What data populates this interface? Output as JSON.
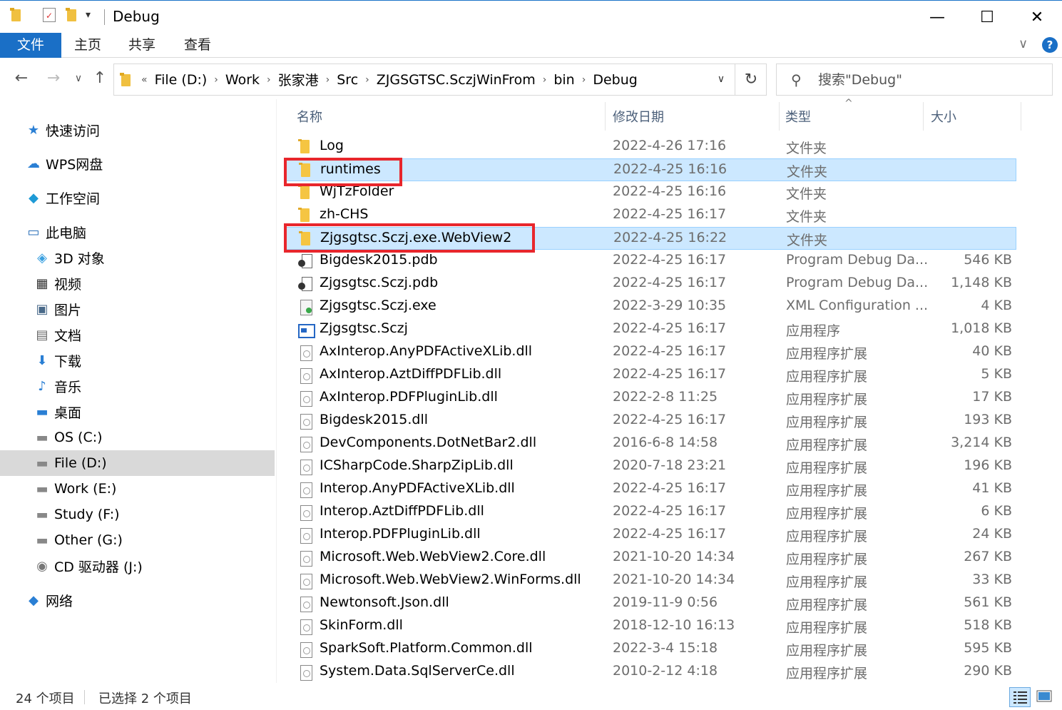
{
  "window": {
    "title": "Debug",
    "minimize_glyph": "—",
    "maximize_glyph": "☐",
    "close_glyph": "✕"
  },
  "ribbon": {
    "tabs": [
      "文件",
      "主页",
      "共享",
      "查看"
    ],
    "expand_glyph": "∨",
    "help_glyph": "?"
  },
  "nav": {
    "back_glyph": "←",
    "forward_glyph": "→",
    "recent_glyph": "∨",
    "up_glyph": "↑"
  },
  "address": {
    "overflow": "«",
    "crumbs": [
      "File (D:)",
      "Work",
      "张家港",
      "Src",
      "ZJGSGTSC.SczjWinFrom",
      "bin",
      "Debug"
    ],
    "separator": "›",
    "dropdown_glyph": "∨",
    "refresh_glyph": "↻"
  },
  "search": {
    "placeholder": "搜索\"Debug\"",
    "icon": "search-icon"
  },
  "sidebar": {
    "items": [
      {
        "label": "快速访问",
        "icon": "star-icon",
        "glyph": "★",
        "color": "#2a7fd4"
      },
      {
        "label": "WPS网盘",
        "icon": "cloud-icon",
        "glyph": "☁",
        "color": "#2a7fd4"
      },
      {
        "label": "工作空间",
        "icon": "workspace-icon",
        "glyph": "◆",
        "color": "#1e9ad6"
      },
      {
        "label": "此电脑",
        "icon": "computer-icon",
        "glyph": "▭",
        "color": "#2a6fb8"
      },
      {
        "label": "3D 对象",
        "icon": "cube-icon",
        "glyph": "◈",
        "color": "#3aa0e0"
      },
      {
        "label": "视频",
        "icon": "film-icon",
        "glyph": "▦",
        "color": "#333"
      },
      {
        "label": "图片",
        "icon": "picture-icon",
        "glyph": "▣",
        "color": "#4a6a8a"
      },
      {
        "label": "文档",
        "icon": "document-icon",
        "glyph": "▤",
        "color": "#666"
      },
      {
        "label": "下载",
        "icon": "download-icon",
        "glyph": "⬇",
        "color": "#2a7fd4"
      },
      {
        "label": "音乐",
        "icon": "music-icon",
        "glyph": "♪",
        "color": "#2a7fd4"
      },
      {
        "label": "桌面",
        "icon": "desktop-icon",
        "glyph": "▬",
        "color": "#2a7fd4"
      },
      {
        "label": "OS (C:)",
        "icon": "drive-icon",
        "glyph": "▬",
        "color": "#888"
      },
      {
        "label": "File (D:)",
        "icon": "drive-icon",
        "glyph": "▬",
        "color": "#888"
      },
      {
        "label": "Work (E:)",
        "icon": "drive-icon",
        "glyph": "▬",
        "color": "#888"
      },
      {
        "label": "Study (F:)",
        "icon": "drive-icon",
        "glyph": "▬",
        "color": "#888"
      },
      {
        "label": "Other (G:)",
        "icon": "drive-icon",
        "glyph": "▬",
        "color": "#888"
      },
      {
        "label": "CD 驱动器 (J:)",
        "icon": "cd-drive-icon",
        "glyph": "◉",
        "color": "#777"
      },
      {
        "label": "网络",
        "icon": "network-icon",
        "glyph": "◆",
        "color": "#2a7fd4"
      }
    ],
    "selected_index": 12
  },
  "columns": {
    "name": "名称",
    "date": "修改日期",
    "type": "类型",
    "size": "大小",
    "sort_glyph": "^"
  },
  "files": [
    {
      "name": "Log",
      "date": "2022-4-26 17:16",
      "type": "文件夹",
      "size": "",
      "icon": "folder"
    },
    {
      "name": "runtimes",
      "date": "2022-4-25 16:16",
      "type": "文件夹",
      "size": "",
      "icon": "folder",
      "selected": true
    },
    {
      "name": "WjTzFolder",
      "date": "2022-4-25 16:16",
      "type": "文件夹",
      "size": "",
      "icon": "folder"
    },
    {
      "name": "zh-CHS",
      "date": "2022-4-25 16:17",
      "type": "文件夹",
      "size": "",
      "icon": "folder"
    },
    {
      "name": "Zjgsgtsc.Sczj.exe.WebView2",
      "date": "2022-4-25 16:22",
      "type": "文件夹",
      "size": "",
      "icon": "folder",
      "selected": true
    },
    {
      "name": "Bigdesk2015.pdb",
      "date": "2022-4-25 16:17",
      "type": "Program Debug Da...",
      "size": "546 KB",
      "icon": "pdb"
    },
    {
      "name": "Zjgsgtsc.Sczj.pdb",
      "date": "2022-4-25 16:17",
      "type": "Program Debug Da...",
      "size": "1,148 KB",
      "icon": "pdb"
    },
    {
      "name": "Zjgsgtsc.Sczj.exe",
      "date": "2022-3-29 10:35",
      "type": "XML Configuration ...",
      "size": "4 KB",
      "icon": "xml"
    },
    {
      "name": "Zjgsgtsc.Sczj",
      "date": "2022-4-25 16:17",
      "type": "应用程序",
      "size": "1,018 KB",
      "icon": "exe"
    },
    {
      "name": "AxInterop.AnyPDFActiveXLib.dll",
      "date": "2022-4-25 16:17",
      "type": "应用程序扩展",
      "size": "40 KB",
      "icon": "doc"
    },
    {
      "name": "AxInterop.AztDiffPDFLib.dll",
      "date": "2022-4-25 16:17",
      "type": "应用程序扩展",
      "size": "5 KB",
      "icon": "doc"
    },
    {
      "name": "AxInterop.PDFPluginLib.dll",
      "date": "2022-2-8 11:25",
      "type": "应用程序扩展",
      "size": "17 KB",
      "icon": "doc"
    },
    {
      "name": "Bigdesk2015.dll",
      "date": "2022-4-25 16:17",
      "type": "应用程序扩展",
      "size": "193 KB",
      "icon": "doc"
    },
    {
      "name": "DevComponents.DotNetBar2.dll",
      "date": "2016-6-8 14:58",
      "type": "应用程序扩展",
      "size": "3,214 KB",
      "icon": "doc"
    },
    {
      "name": "ICSharpCode.SharpZipLib.dll",
      "date": "2020-7-18 23:21",
      "type": "应用程序扩展",
      "size": "196 KB",
      "icon": "doc"
    },
    {
      "name": "Interop.AnyPDFActiveXLib.dll",
      "date": "2022-4-25 16:17",
      "type": "应用程序扩展",
      "size": "41 KB",
      "icon": "doc"
    },
    {
      "name": "Interop.AztDiffPDFLib.dll",
      "date": "2022-4-25 16:17",
      "type": "应用程序扩展",
      "size": "6 KB",
      "icon": "doc"
    },
    {
      "name": "Interop.PDFPluginLib.dll",
      "date": "2022-4-25 16:17",
      "type": "应用程序扩展",
      "size": "24 KB",
      "icon": "doc"
    },
    {
      "name": "Microsoft.Web.WebView2.Core.dll",
      "date": "2021-10-20 14:34",
      "type": "应用程序扩展",
      "size": "267 KB",
      "icon": "doc"
    },
    {
      "name": "Microsoft.Web.WebView2.WinForms.dll",
      "date": "2021-10-20 14:34",
      "type": "应用程序扩展",
      "size": "33 KB",
      "icon": "doc"
    },
    {
      "name": "Newtonsoft.Json.dll",
      "date": "2019-11-9 0:56",
      "type": "应用程序扩展",
      "size": "561 KB",
      "icon": "doc"
    },
    {
      "name": "SkinForm.dll",
      "date": "2018-12-10 16:13",
      "type": "应用程序扩展",
      "size": "518 KB",
      "icon": "doc"
    },
    {
      "name": "SparkSoft.Platform.Common.dll",
      "date": "2022-3-4 15:18",
      "type": "应用程序扩展",
      "size": "595 KB",
      "icon": "doc"
    },
    {
      "name": "System.Data.SqlServerCe.dll",
      "date": "2010-2-12 4:18",
      "type": "应用程序扩展",
      "size": "290 KB",
      "icon": "doc"
    }
  ],
  "status": {
    "count": "24 个项目",
    "selection": "已选择 2 个项目"
  },
  "colors": {
    "accent": "#1a6fc6",
    "selection_bg": "#cce8ff",
    "highlight_box": "#e8262c"
  }
}
